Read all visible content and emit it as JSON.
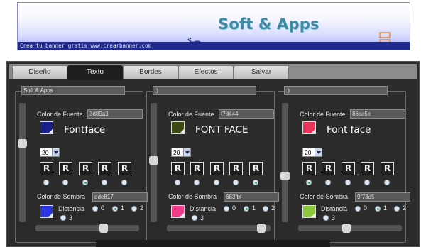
{
  "banner": {
    "title": "Soft & Apps",
    "footer_text": "Crea tu banner gratis www.crearbanner.com",
    "title_color": "#3d89a3"
  },
  "tabs": [
    {
      "label": "Diseño",
      "active": false
    },
    {
      "label": "Texto",
      "active": true
    },
    {
      "label": "Bordes",
      "active": false
    },
    {
      "label": "Efectos",
      "active": false
    },
    {
      "label": "Salvar",
      "active": false
    }
  ],
  "labels": {
    "font_color": "Color de Fuente",
    "shadow_color": "Color de Sombra",
    "distance": "Distancia",
    "distance_options": [
      "0",
      "1",
      "2",
      "3"
    ]
  },
  "panels": [
    {
      "text": "Soft & Apps",
      "font_color": "3d89a3",
      "font_swatch": "#1a1f8c",
      "preview": "Fontface",
      "font_size": "20",
      "shadow_color": "dde817",
      "shadow_swatch": "#2a36e0",
      "styles": [
        "R",
        "R",
        "R",
        "R",
        "R"
      ],
      "selected_style": 2,
      "distance_selected": 1,
      "vslider_value": 0.33,
      "hslider_value": 0.67
    },
    {
      "text": ":)",
      "font_color": "f7d444",
      "font_swatch": "#3a4a12",
      "preview": "FONT FACE",
      "font_size": "20",
      "shadow_color": "683fbf",
      "shadow_swatch": "#f23a8a",
      "styles": [
        "R",
        "R",
        "R",
        "R",
        "R"
      ],
      "selected_style": 4,
      "distance_selected": 1,
      "vslider_value": 0.48,
      "hslider_value": 0.95
    },
    {
      "text": ":)",
      "font_color": "86ca5e",
      "font_swatch": "#e8345a",
      "preview": "Font face",
      "font_size": "20",
      "shadow_color": "9f73d5",
      "shadow_swatch": "#8dc83a",
      "styles": [
        "R",
        "R",
        "R",
        "R",
        "R"
      ],
      "selected_style": 0,
      "distance_selected": 1,
      "vslider_value": 0.62,
      "hslider_value": 0.46
    }
  ]
}
